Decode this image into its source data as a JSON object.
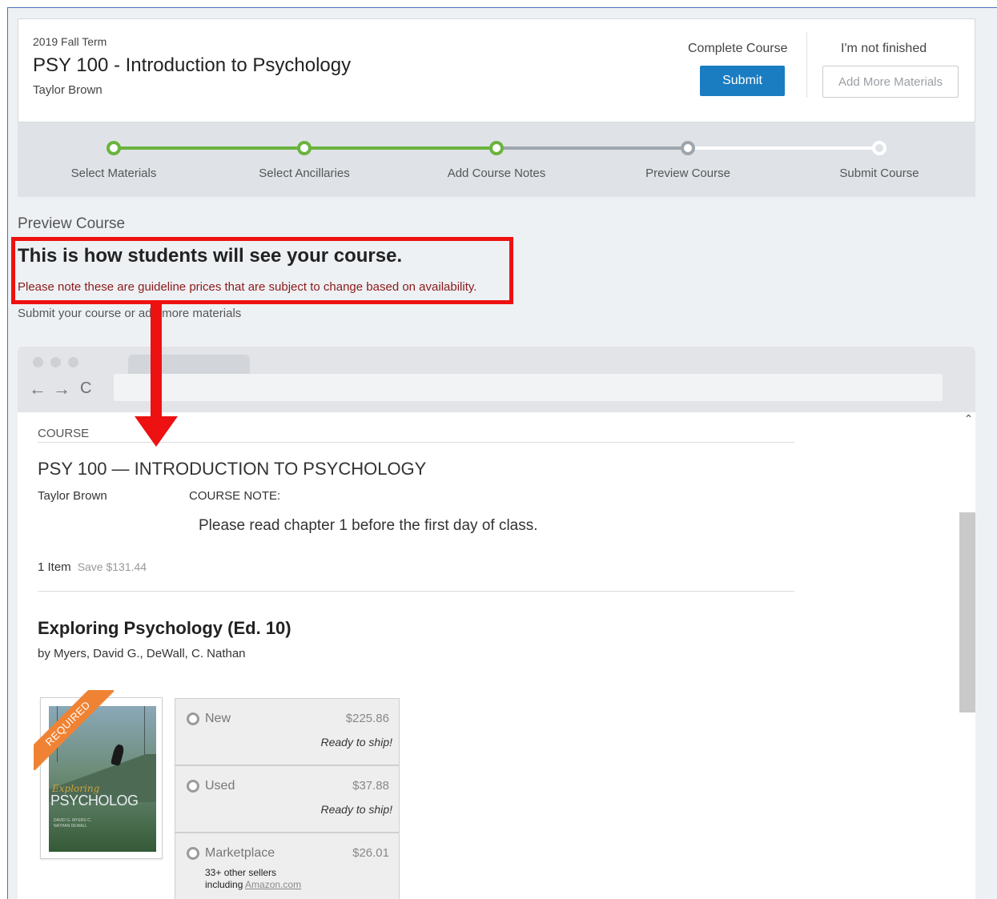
{
  "header": {
    "term": "2019 Fall Term",
    "course_title": "PSY 100 - Introduction to Psychology",
    "instructor": "Taylor Brown",
    "complete_label": "Complete Course",
    "submit_label": "Submit",
    "not_finished_label": "I'm not finished",
    "add_more_label": "Add More Materials"
  },
  "steps": {
    "items": [
      {
        "label": "Select Materials",
        "state": "complete"
      },
      {
        "label": "Select Ancillaries",
        "state": "complete"
      },
      {
        "label": "Add Course Notes",
        "state": "complete"
      },
      {
        "label": "Preview Course",
        "state": "current"
      },
      {
        "label": "Submit Course",
        "state": "pending"
      }
    ],
    "colors": {
      "complete": "#6ab43e",
      "current": "#9ea6ad",
      "pending": "#ffffff"
    }
  },
  "preview": {
    "heading": "Preview Course",
    "subheading": "This is how students will see your course.",
    "guideline_note": "Please note these are guideline prices that are subject to change based on availability.",
    "submit_text": "Submit your course or add more materials"
  },
  "browser": {
    "back_icon": "←",
    "forward_icon": "→",
    "reload_icon": "C"
  },
  "student_view": {
    "section_label": "COURSE",
    "course_title": "PSY 100 — INTRODUCTION TO PSYCHOLOGY",
    "instructor": "Taylor Brown",
    "note_label": "COURSE NOTE:",
    "note_text": "Please read chapter 1 before the first day of class.",
    "items_count": "1 Item",
    "savings": "Save $131.44",
    "book": {
      "title": "Exploring Psychology (Ed. 10)",
      "authors": "by Myers, David G., DeWall, C. Nathan",
      "badge": "REQUIRED",
      "cover_subtitle": "Exploring",
      "cover_title": "PSYCHOLOG",
      "cover_authors": "DAVID G. MYERS C. NATHAN DEWALL"
    },
    "options": [
      {
        "label": "New",
        "price": "$225.86",
        "availability": "Ready to ship!"
      },
      {
        "label": "Used",
        "price": "$37.88",
        "availability": "Ready to ship!"
      },
      {
        "label": "Marketplace",
        "price": "$26.01",
        "sellers_line1": "33+ other sellers",
        "sellers_line2": "including",
        "sellers_link": "Amazon.com"
      }
    ]
  },
  "annotation": {
    "highlight_color": "#ee1111"
  }
}
